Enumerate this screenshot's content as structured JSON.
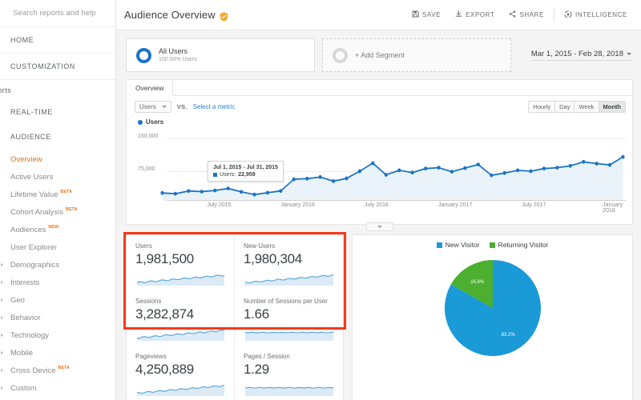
{
  "sidebar": {
    "search_placeholder": "Search reports and help",
    "top_items": [
      {
        "label": "HOME",
        "name": "sidebar-item-home"
      },
      {
        "label": "CUSTOMIZATION",
        "name": "sidebar-item-customization"
      }
    ],
    "reports_label": "ports",
    "sections": [
      {
        "label": "REAL-TIME",
        "name": "sidebar-section-real-time"
      },
      {
        "label": "AUDIENCE",
        "name": "sidebar-section-audience"
      }
    ],
    "items": [
      {
        "label": "Overview",
        "badge": "",
        "active": true,
        "expandable": false
      },
      {
        "label": "Active Users",
        "badge": "",
        "active": false,
        "expandable": false
      },
      {
        "label": "Lifetime Value",
        "badge": "BETA",
        "active": false,
        "expandable": false
      },
      {
        "label": "Cohort Analysis",
        "badge": "BETA",
        "active": false,
        "expandable": false
      },
      {
        "label": "Audiences",
        "badge": "NEW",
        "active": false,
        "expandable": false
      },
      {
        "label": "User Explorer",
        "badge": "",
        "active": false,
        "expandable": false
      },
      {
        "label": "Demographics",
        "badge": "",
        "active": false,
        "expandable": true
      },
      {
        "label": "Interests",
        "badge": "",
        "active": false,
        "expandable": true
      },
      {
        "label": "Geo",
        "badge": "",
        "active": false,
        "expandable": true
      },
      {
        "label": "Behavior",
        "badge": "",
        "active": false,
        "expandable": true
      },
      {
        "label": "Technology",
        "badge": "",
        "active": false,
        "expandable": true
      },
      {
        "label": "Mobile",
        "badge": "",
        "active": false,
        "expandable": true
      },
      {
        "label": "Cross Device",
        "badge": "BETA",
        "active": false,
        "expandable": true
      },
      {
        "label": "Custom",
        "badge": "",
        "active": false,
        "expandable": true
      }
    ]
  },
  "header": {
    "title": "Audience Overview",
    "verified_icon": "shield-check-icon",
    "actions": [
      {
        "label": "SAVE",
        "icon": "save-icon"
      },
      {
        "label": "EXPORT",
        "icon": "download-icon"
      },
      {
        "label": "SHARE",
        "icon": "share-icon"
      },
      {
        "label": "INTELLIGENCE",
        "icon": "intelligence-icon"
      }
    ]
  },
  "segments": {
    "all_users": {
      "name": "All Users",
      "sub": "100.00% Users"
    },
    "add_segment_label": "+ Add Segment",
    "date_range": "Mar 1, 2015 - Feb 28, 2018"
  },
  "chart_panel": {
    "tab_label": "Overview",
    "metric_select": "Users",
    "vs_label": "VS.",
    "select_metric_link": "Select a metric",
    "granularity": [
      {
        "label": "Hourly",
        "selected": false
      },
      {
        "label": "Day",
        "selected": false
      },
      {
        "label": "Week",
        "selected": false
      },
      {
        "label": "Month",
        "selected": true
      }
    ],
    "legend_label": "Users",
    "tooltip": {
      "title": "Jul 1, 2015 - Jul 31, 2015",
      "series": "Users:",
      "value": "22,959"
    }
  },
  "chart_data": {
    "type": "line",
    "title": "Users",
    "xlabel": "",
    "ylabel": "Users",
    "ylim": [
      0,
      150000
    ],
    "yticks": [
      150000,
      75000
    ],
    "ytick_labels": [
      "150,000",
      "75,000"
    ],
    "grid": true,
    "legend_position": "top-left",
    "x_tick_labels": [
      "July 2015",
      "January 2016",
      "July 2016",
      "January 2017",
      "July 2017",
      "January 2018"
    ],
    "x_tick_index": [
      4,
      10,
      16,
      22,
      28,
      34
    ],
    "x": [
      "Mar 2015",
      "Apr 2015",
      "May 2015",
      "Jun 2015",
      "Jul 2015",
      "Aug 2015",
      "Sep 2015",
      "Oct 2015",
      "Nov 2015",
      "Dec 2015",
      "Jan 2016",
      "Feb 2016",
      "Mar 2016",
      "Apr 2016",
      "May 2016",
      "Jun 2016",
      "Jul 2016",
      "Aug 2016",
      "Sep 2016",
      "Oct 2016",
      "Nov 2016",
      "Dec 2016",
      "Jan 2017",
      "Feb 2017",
      "Mar 2017",
      "Apr 2017",
      "May 2017",
      "Jun 2017",
      "Jul 2017",
      "Aug 2017",
      "Sep 2017",
      "Oct 2017",
      "Nov 2017",
      "Dec 2017",
      "Jan 2018",
      "Feb 2018"
    ],
    "series": [
      {
        "name": "Users",
        "color": "#1a73c8",
        "values": [
          17500,
          15800,
          22000,
          20500,
          22959,
          27500,
          20000,
          14000,
          18000,
          22000,
          48000,
          49500,
          53000,
          44000,
          50000,
          66000,
          84000,
          58000,
          68000,
          63000,
          72000,
          74000,
          65000,
          73000,
          81000,
          57000,
          62000,
          68000,
          66000,
          72000,
          74000,
          78000,
          87000,
          83000,
          80000,
          98000
        ]
      }
    ]
  },
  "metrics": {
    "cells": [
      {
        "label": "Users",
        "value": "1,981,500"
      },
      {
        "label": "New Users",
        "value": "1,980,304"
      },
      {
        "label": "Sessions",
        "value": "3,282,874"
      },
      {
        "label": "Number of Sessions per User",
        "value": "1.66"
      },
      {
        "label": "Pageviews",
        "value": "4,250,889"
      },
      {
        "label": "Pages / Session",
        "value": "1.29"
      }
    ],
    "highlight_color": "#f43a1b"
  },
  "pie_chart": {
    "type": "pie",
    "title": "",
    "legend_position": "top",
    "labels": [
      "New Visitor",
      "Returning Visitor"
    ],
    "values": [
      83.2,
      16.8
    ],
    "value_labels": [
      "83.2%",
      "16.8%"
    ],
    "colors": [
      "#1a9ad6",
      "#4caf2f"
    ]
  }
}
